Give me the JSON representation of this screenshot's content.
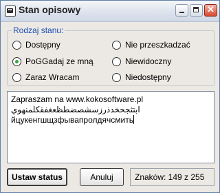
{
  "window": {
    "title": "Stan opisowy",
    "controls": {
      "close_symbol": "✕"
    }
  },
  "status_group": {
    "legend": "Rodzaj stanu:",
    "options": [
      {
        "label": "Dostępny",
        "checked": false
      },
      {
        "label": "PoGGadaj ze mną",
        "checked": true
      },
      {
        "label": "Zaraz Wracam",
        "checked": false
      },
      {
        "label": "Nie przeszkadzać",
        "checked": false
      },
      {
        "label": "Niewidoczny",
        "checked": false
      },
      {
        "label": "Niedostępny",
        "checked": false
      }
    ]
  },
  "description": {
    "lines": [
      "Zapraszam na www.kokosoftware.pl",
      "ابتثجحخدذرزسشصضطظعغفقكلمنهوي",
      "йцукенгшщзфывапролдячсмить"
    ]
  },
  "actions": {
    "set_status_label": "Ustaw status",
    "cancel_label": "Anuluj"
  },
  "counter": {
    "text": "Znaków: 149 z 255"
  },
  "colors": {
    "accent_legend": "#1d4fb3",
    "radio_selected": "#3ea043",
    "close_button": "#d9472d"
  }
}
